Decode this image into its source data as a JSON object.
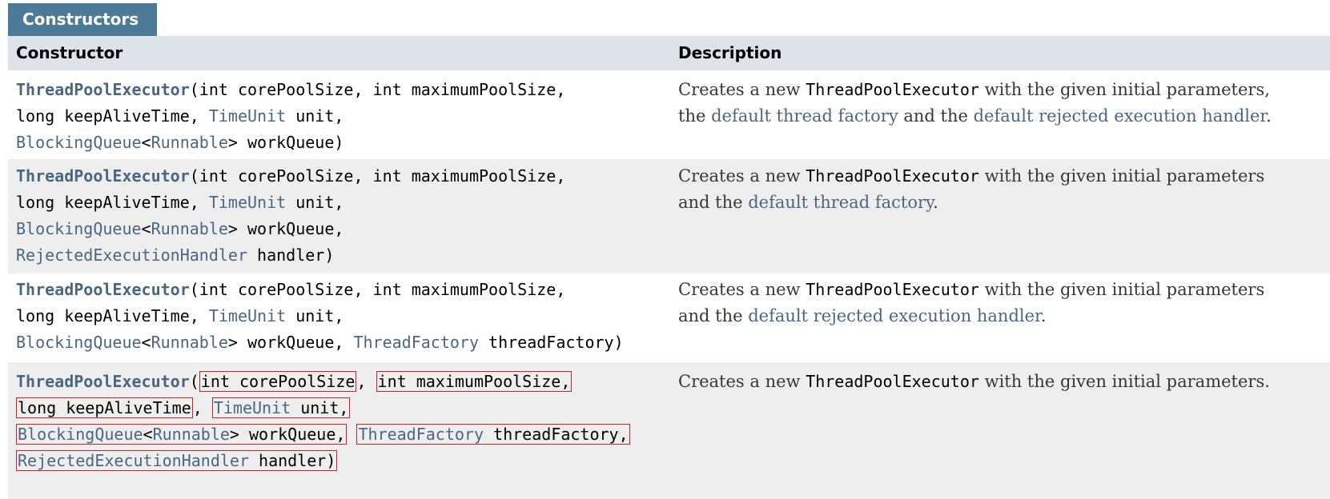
{
  "section_title": "Constructors",
  "headers": {
    "constructor": "Constructor",
    "description": "Description"
  },
  "colors": {
    "tab": "#4d7a97",
    "header_bg": "#dee3e9",
    "link": "#4a6782",
    "highlight_box": "#cc1f2a"
  },
  "rows": [
    {
      "name": "ThreadPoolExecutor",
      "params": {
        "p1": "int corePoolSize",
        "p2": "int maximumPoolSize",
        "p3": "long keepAliveTime",
        "p4_type": "TimeUnit",
        "p4_name": " unit",
        "p5_type": "BlockingQueue",
        "p5_generic": "Runnable",
        "p5_name": "> workQueue"
      },
      "desc": {
        "t1": "Creates a new ",
        "code": "ThreadPoolExecutor",
        "t2": " with the given initial parameters,",
        "t3": "the ",
        "link1": "default thread factory",
        "t4": " and the ",
        "link2": "default rejected execution handler",
        "t5": "."
      }
    },
    {
      "name": "ThreadPoolExecutor",
      "params": {
        "p1": "int corePoolSize",
        "p2": "int maximumPoolSize",
        "p3": "long keepAliveTime",
        "p4_type": "TimeUnit",
        "p4_name": " unit",
        "p5_type": "BlockingQueue",
        "p5_generic": "Runnable",
        "p5_name": "> workQueue",
        "p6_type": "RejectedExecutionHandler",
        "p6_name": " handler"
      },
      "desc": {
        "t1": "Creates a new ",
        "code": "ThreadPoolExecutor",
        "t2": " with the given initial parameters",
        "t3": "and the ",
        "link1": "default thread factory",
        "t4": "."
      }
    },
    {
      "name": "ThreadPoolExecutor",
      "params": {
        "p1": "int corePoolSize",
        "p2": "int maximumPoolSize",
        "p3": "long keepAliveTime",
        "p4_type": "TimeUnit",
        "p4_name": " unit",
        "p5_type": "BlockingQueue",
        "p5_generic": "Runnable",
        "p5_name": "> workQueue",
        "p6_type": "ThreadFactory",
        "p6_name": " threadFactory"
      },
      "desc": {
        "t1": "Creates a new ",
        "code": "ThreadPoolExecutor",
        "t2": " with the given initial parameters",
        "t3": "and the ",
        "link1": "default rejected execution handler",
        "t4": "."
      }
    },
    {
      "name": "ThreadPoolExecutor",
      "params": {
        "p1": "int corePoolSize",
        "p2": "int maximumPoolSize",
        "p3": "long keepAliveTime",
        "p4_type": "TimeUnit",
        "p4_name": " unit",
        "p5_type": "BlockingQueue",
        "p5_generic": "Runnable",
        "p5_name": "> workQueue",
        "p6_type": "ThreadFactory",
        "p6_name": " threadFactory",
        "p7_type": "RejectedExecutionHandler",
        "p7_name": " handler"
      },
      "desc": {
        "t1": "Creates a new ",
        "code": "ThreadPoolExecutor",
        "t2": " with the given initial parameters."
      }
    }
  ]
}
